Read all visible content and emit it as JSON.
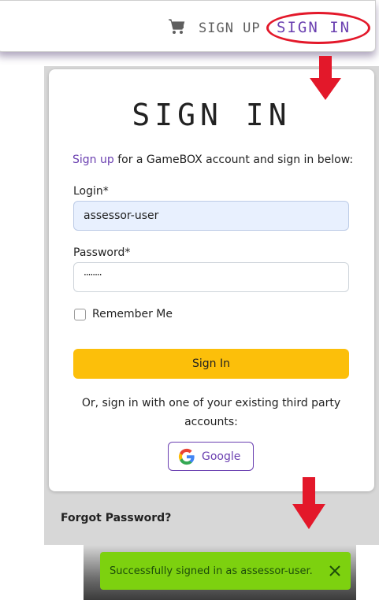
{
  "navbar": {
    "cart_icon": "shopping-cart-icon",
    "sign_up": "SIGN UP",
    "sign_in": "SIGN IN"
  },
  "card": {
    "title": "SIGN IN",
    "intro_link": "Sign up",
    "intro_rest": " for a GameBOX account and sign in below:",
    "login_label": "Login*",
    "login_value": "assessor-user",
    "password_label": "Password*",
    "password_value": "········",
    "remember_label": "Remember Me",
    "submit_label": "Sign In",
    "third_party_text": "Or, sign in with one of your existing third party accounts:",
    "google_label": "Google"
  },
  "footer": {
    "forgot_label": "Forgot Password?"
  },
  "toast": {
    "message": "Successfully signed in as assessor-user.",
    "close_icon": "close-icon"
  },
  "colors": {
    "accent": "#6a3fb0",
    "button": "#fcbf0a",
    "toast": "#7dd10f",
    "annotation": "#e3182a"
  }
}
